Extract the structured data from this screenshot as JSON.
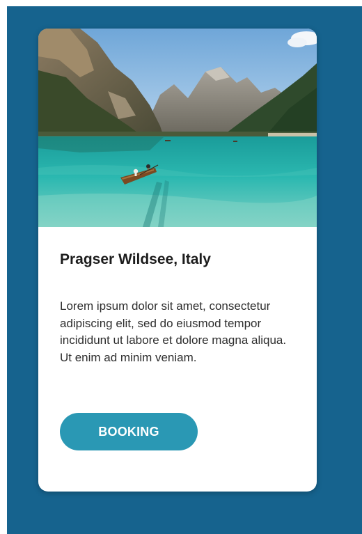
{
  "card": {
    "image_subject": "lake-landscape-photo",
    "title": "Pragser Wildsee, Italy",
    "description": "Lorem ipsum dolor sit amet, consectetur adipiscing elit, sed do eiusmod tempor incididunt ut labore et dolore magna aliqua. Ut enim ad minim veniam.",
    "button_label": "BOOKING"
  },
  "colors": {
    "page_background": "#16638e",
    "card_background": "#ffffff",
    "button_background": "#2a98b4",
    "button_text": "#ffffff",
    "title_text": "#1c1c1c"
  }
}
